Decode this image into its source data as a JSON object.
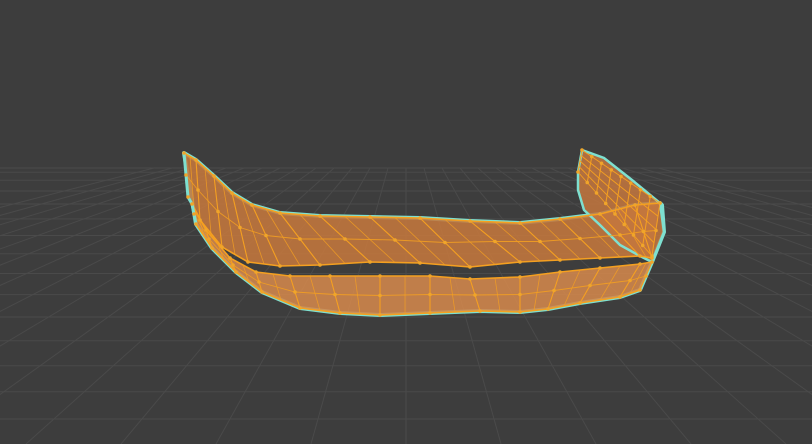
{
  "viewport": {
    "background": "#3d3d3d",
    "grid_color": "#4a4a4a",
    "grid_visible": true
  },
  "mesh": {
    "object_type": "selected-mesh",
    "mode": "edit-mode",
    "face_fill": "#c4773e",
    "face_fill_light": "#d3874c",
    "edge_color": "#f5a020",
    "vertex_color": "#f0a52a",
    "outline_color": "#7ee0d0"
  }
}
